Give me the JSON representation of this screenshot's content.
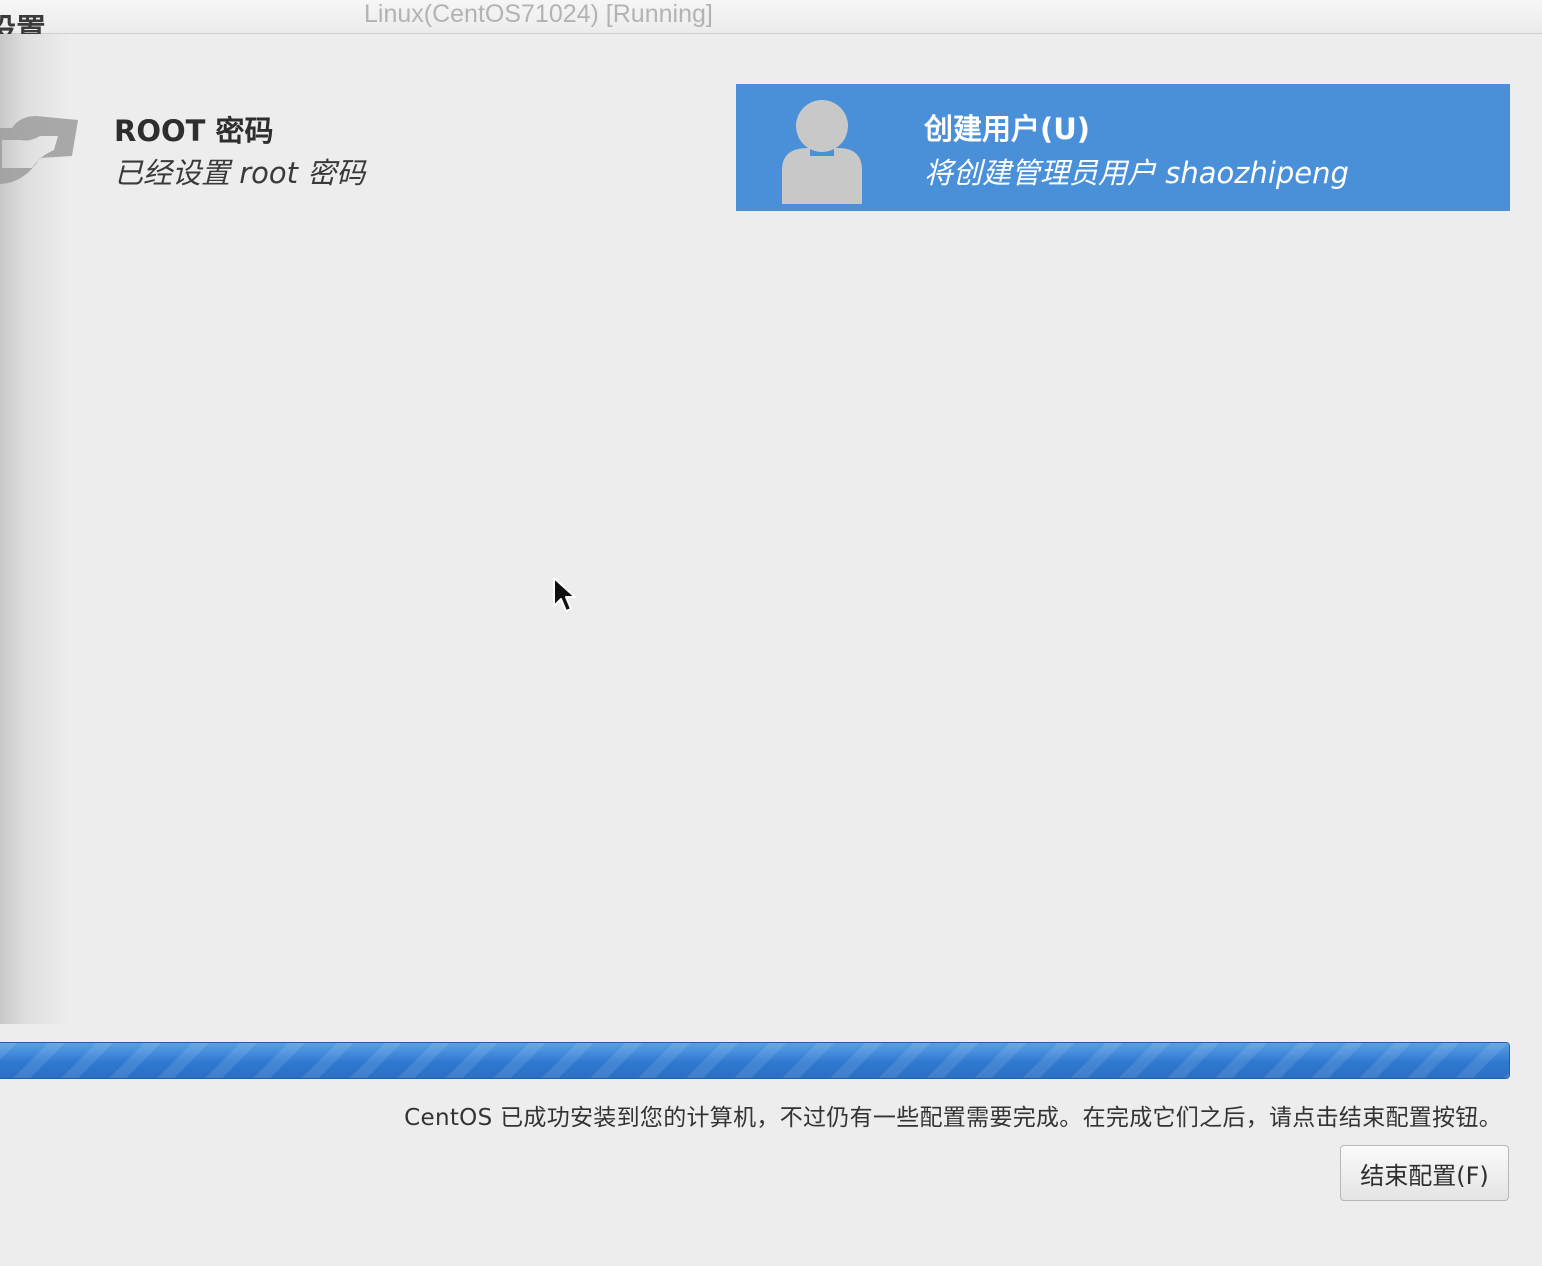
{
  "window": {
    "title": "Linux(CentOS71024) [Running]",
    "clipped_heading": "设置"
  },
  "spokes": {
    "root": {
      "title": "ROOT 密码",
      "status": "已经设置 root 密码",
      "icon": "key-icon"
    },
    "user": {
      "title": "创建用户(U)",
      "status": "将创建管理员用户 shaozhipeng",
      "icon": "user-icon",
      "selected": true,
      "accent_color": "#4a90d9"
    }
  },
  "progress": {
    "fraction": 1.0,
    "color": "#2f79d0"
  },
  "footer": {
    "message": "CentOS 已成功安装到您的计算机，不过仍有一些配置需要完成。在完成它们之后，请点击结束配置按钮。",
    "finish_button_label": "结束配置(F)"
  }
}
